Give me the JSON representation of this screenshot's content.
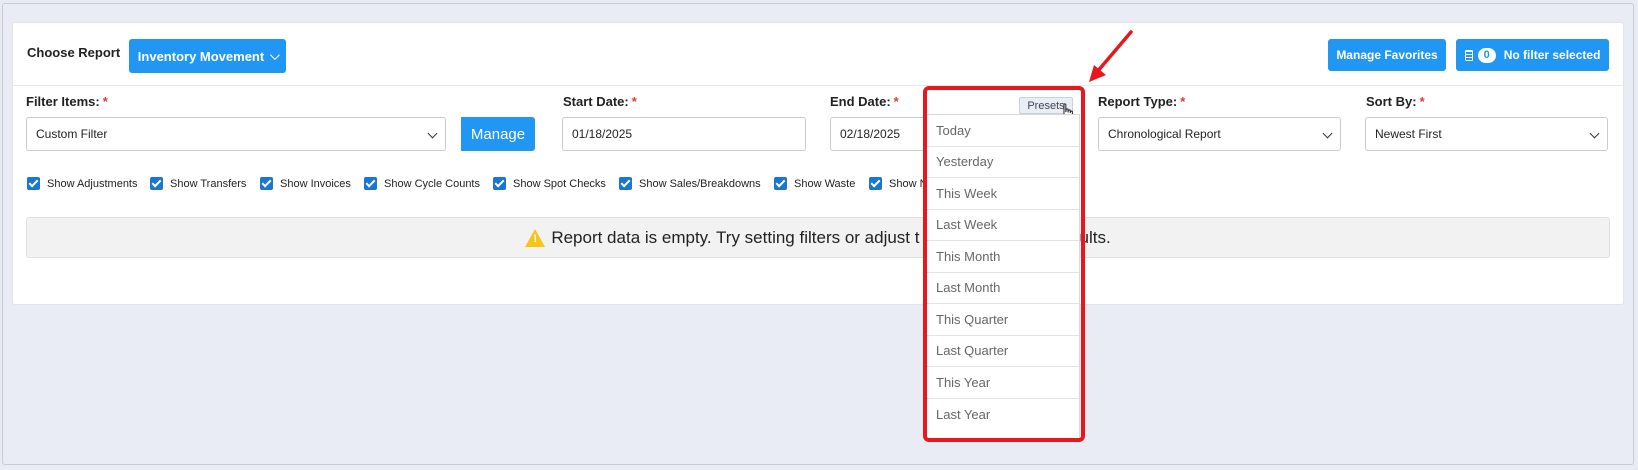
{
  "header": {
    "choose_report_label": "Choose Report",
    "report_button": "Inventory Movement",
    "manage_favorites": "Manage Favorites",
    "filter_badge": "0",
    "filter_label": "No filter selected"
  },
  "form": {
    "filter_items_label": "Filter Items:",
    "filter_items_value": "Custom Filter",
    "manage_button": "Manage",
    "start_date_label": "Start Date:",
    "start_date_value": "01/18/2025",
    "end_date_label": "End Date:",
    "end_date_value": "02/18/2025",
    "presets_button": "Presets",
    "report_type_label": "Report Type:",
    "report_type_value": "Chronological Report",
    "sort_by_label": "Sort By:",
    "sort_by_value": "Newest First",
    "required_mark": "*"
  },
  "checkboxes": [
    {
      "label": "Show Adjustments",
      "checked": true
    },
    {
      "label": "Show Transfers",
      "checked": true
    },
    {
      "label": "Show Invoices",
      "checked": true
    },
    {
      "label": "Show Cycle Counts",
      "checked": true
    },
    {
      "label": "Show Spot Checks",
      "checked": true
    },
    {
      "label": "Show Sales/Breakdowns",
      "checked": true
    },
    {
      "label": "Show Waste",
      "checked": true
    },
    {
      "label": "Show N",
      "checked": true
    }
  ],
  "alert": {
    "text_left": "Report data is empty. Try setting filters or adjust t",
    "text_right": "ults."
  },
  "presets_menu": [
    "Today",
    "Yesterday",
    "This Week",
    "Last Week",
    "This Month",
    "Last Month",
    "This Quarter",
    "Last Quarter",
    "This Year",
    "Last Year"
  ],
  "colors": {
    "primary": "#2196f3",
    "required": "#e53935",
    "highlight": "#e8171e",
    "warning": "#f5c518"
  }
}
